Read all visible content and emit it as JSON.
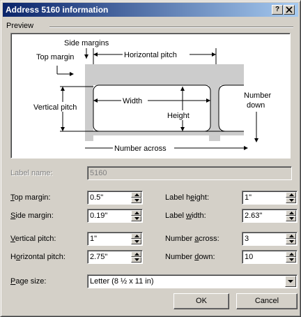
{
  "window": {
    "title": "Address 5160 information",
    "help_button": "?",
    "close_button": "X"
  },
  "preview": {
    "group_label": "Preview",
    "side_margins": "Side margins",
    "top_margin": "Top margin",
    "horizontal_pitch": "Horizontal pitch",
    "vertical_pitch": "Vertical pitch",
    "width": "Width",
    "height": "Height",
    "number_down_line1": "Number",
    "number_down_line2": "down",
    "number_across": "Number across"
  },
  "label_name": {
    "label": "Label name:",
    "value": "5160"
  },
  "fields": {
    "top_margin": {
      "label_pre": "",
      "label_key": "T",
      "label_post": "op margin:",
      "value": "0.5\""
    },
    "side_margin": {
      "label_pre": "",
      "label_key": "S",
      "label_post": "ide margin:",
      "value": "0.19\""
    },
    "vertical_pitch": {
      "label_pre": "",
      "label_key": "V",
      "label_post": "ertical pitch:",
      "value": "1\""
    },
    "horizontal_pitch": {
      "label_pre": "H",
      "label_key": "o",
      "label_post": "rizontal pitch:",
      "value": "2.75\""
    },
    "label_height": {
      "label_pre": "Label h",
      "label_key": "e",
      "label_post": "ight:",
      "value": "1\""
    },
    "label_width": {
      "label_pre": "Label ",
      "label_key": "w",
      "label_post": "idth:",
      "value": "2.63\""
    },
    "number_across": {
      "label_pre": "Number ",
      "label_key": "a",
      "label_post": "cross:",
      "value": "3"
    },
    "number_down": {
      "label_pre": "Number ",
      "label_key": "d",
      "label_post": "own:",
      "value": "10"
    }
  },
  "page_size": {
    "label_key": "P",
    "label_post": "age size:",
    "value": "Letter (8 ½ x 11 in)"
  },
  "buttons": {
    "ok": "OK",
    "cancel": "Cancel"
  },
  "colors": {
    "titlebar_start": "#0a246a",
    "titlebar_end": "#a6caf0",
    "face": "#d4d0c8",
    "label_fill": "#cccccc"
  }
}
